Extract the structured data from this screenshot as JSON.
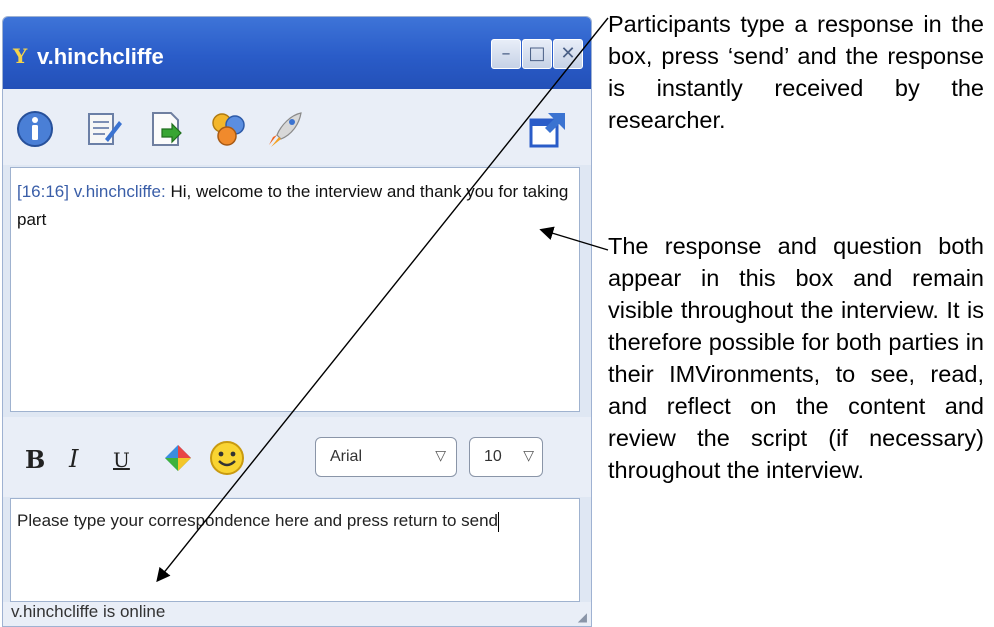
{
  "window": {
    "title": "v.hinchcliffe",
    "controls": {
      "minimize": "–",
      "maximize": "□",
      "close": "✕"
    },
    "app_icon": "yahoo-y-icon"
  },
  "toolbar": {
    "icons": [
      "info-icon",
      "notepad-icon",
      "send-file-icon",
      "contacts-icon",
      "rocket-icon",
      "popout-icon"
    ]
  },
  "history": {
    "messages": [
      {
        "time": "[16:16]",
        "sender": "v.hinchcliffe:",
        "text": "Hi, welcome to the interview and thank you for taking part"
      }
    ]
  },
  "format_bar": {
    "bold": "B",
    "italic": "I",
    "underline": "U",
    "font_name": "Arial",
    "font_size": "10"
  },
  "input": {
    "text": "Please type your correspondence here and press return to send"
  },
  "status": {
    "text": "v.hinchcliffe is online"
  },
  "annotations": {
    "send_note": "Participants type a response in the box, press ‘send’ and the response is instantly received by the researcher.",
    "history_note": "The response and question both appear in this box and remain visible throughout the interview. It is therefore possible for both parties in their IMVironments, to see, read, and reflect on the content and review the script (if necessary) throughout the interview."
  },
  "colors": {
    "titlebar": "#2a5cc8",
    "timestamp": "#3a5ea8",
    "window_bg": "#dfe7f3"
  }
}
